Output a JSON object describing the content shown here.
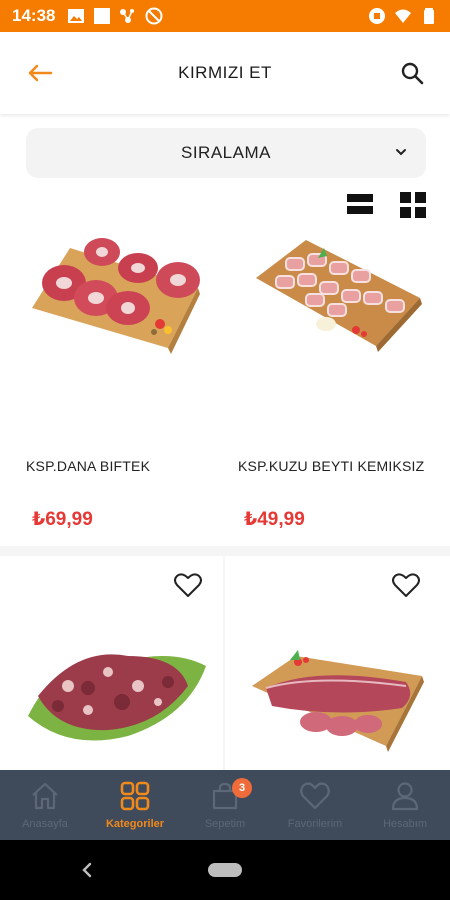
{
  "status_bar": {
    "time": "14:38",
    "background_color": "#f57c00",
    "left_icons": [
      "image-icon",
      "square-icon",
      "connection-icon",
      "no-sync-icon"
    ],
    "right_icons": [
      "vibrate-icon",
      "wifi-icon",
      "battery-icon"
    ]
  },
  "header": {
    "title": "KIRMIZI ET",
    "back_icon": "arrow-left-icon",
    "search_icon": "search-icon",
    "accent_color": "#f28a1b"
  },
  "sort": {
    "label": "SIRALAMA",
    "icon": "chevron-down-icon"
  },
  "view_toggle": [
    "list-view-icon",
    "grid-view-icon"
  ],
  "products": [
    {
      "name": "KSP.DANA BIFTEK",
      "price": "₺69,99",
      "image": "beef-steak-on-board",
      "favorite": false
    },
    {
      "name": "KSP.KUZU BEYTI KEMIKSIZ",
      "price": "₺49,99",
      "image": "lamb-rolls-on-board",
      "favorite": false
    },
    {
      "name": "",
      "price": "",
      "image": "lamb-chunks-with-lettuce",
      "favorite": false
    },
    {
      "name": "",
      "price": "",
      "image": "beef-fillet-on-board",
      "favorite": false
    }
  ],
  "price_color": "#e53935",
  "bottom_nav": {
    "items": [
      {
        "label": "Anasayfa",
        "icon": "home-icon",
        "active": false
      },
      {
        "label": "Kategoriler",
        "icon": "categories-icon",
        "active": true
      },
      {
        "label": "Sepetim",
        "icon": "shopping-bag-icon",
        "active": false,
        "badge": "3"
      },
      {
        "label": "Favorilerim",
        "icon": "heart-icon",
        "active": false
      },
      {
        "label": "Hesabım",
        "icon": "user-icon",
        "active": false
      }
    ],
    "background_color": "#3f4a5a",
    "active_color": "#f28a1b",
    "badge_color": "#ef6c3a"
  },
  "system_nav": [
    "back-icon",
    "home-pill"
  ]
}
